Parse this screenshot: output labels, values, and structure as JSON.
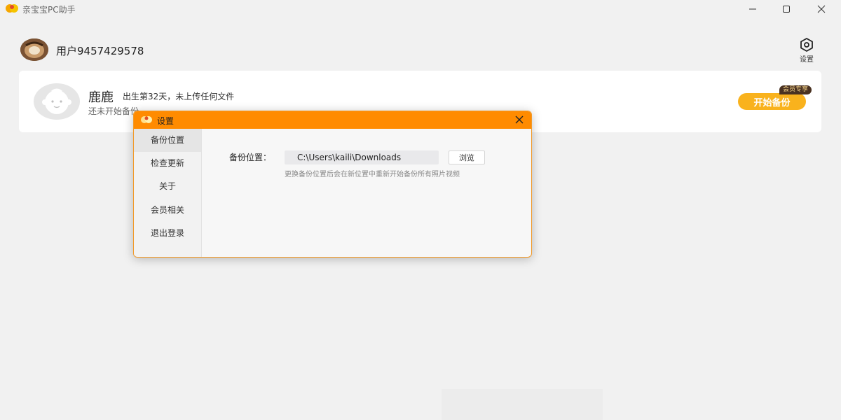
{
  "window": {
    "title": "亲宝宝PC助手",
    "controls": {
      "minimize_icon": "minimize-icon",
      "maximize_icon": "maximize-icon",
      "close_icon": "close-icon"
    }
  },
  "header": {
    "username": "用户9457429578",
    "settings_label": "设置"
  },
  "baby": {
    "name": "鹿鹿",
    "meta": "出生第32天，未上传任何文件",
    "status": "还未开始备份",
    "start_button": "开始备份",
    "vip_badge": "会员专享"
  },
  "modal": {
    "title": "设置",
    "sidebar": [
      {
        "label": "备份位置",
        "active": true
      },
      {
        "label": "检查更新",
        "active": false
      },
      {
        "label": "关于",
        "active": false
      },
      {
        "label": "会员相关",
        "active": false
      },
      {
        "label": "退出登录",
        "active": false
      }
    ],
    "backup": {
      "label": "备份位置：",
      "path": "C:\\Users\\kaili\\Downloads",
      "browse_label": "浏览",
      "hint": "更换备份位置后会在新位置中重新开始备份所有照片视频"
    }
  },
  "colors": {
    "accent": "#ff8b00",
    "button": "#f9b21d",
    "vip_badge_bg": "#4a3222",
    "vip_badge_text": "#f2d28a",
    "background": "#f1f1f1"
  }
}
